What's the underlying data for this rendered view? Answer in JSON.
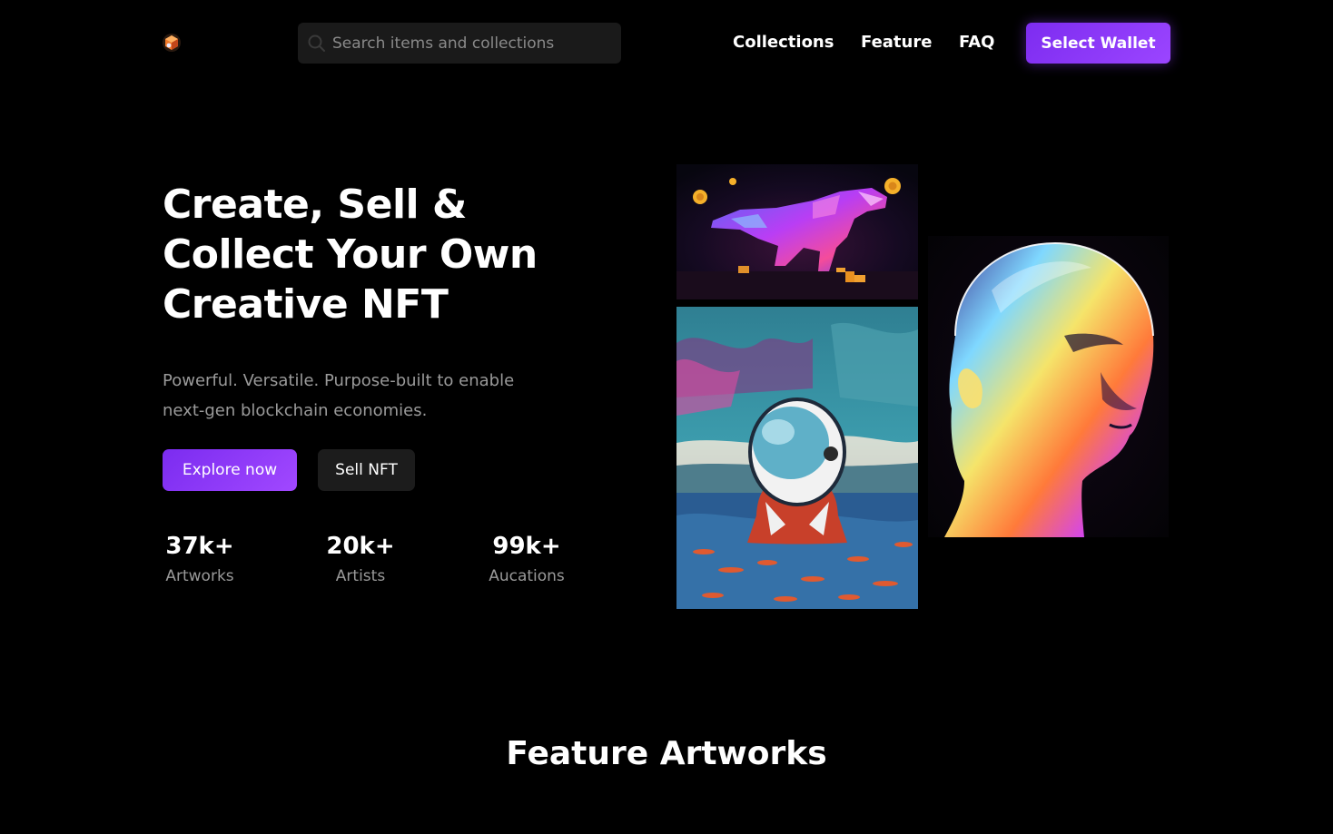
{
  "header": {
    "search": {
      "placeholder": "Search items and collections"
    },
    "nav": [
      "Collections",
      "Feature",
      "FAQ"
    ],
    "wallet_button": "Select Wallet"
  },
  "hero": {
    "title_lines": [
      "Create, Sell &",
      "Collect Your Own",
      "Creative NFT"
    ],
    "subtitle_lines": [
      "Powerful. Versatile. Purpose-built to enable",
      "next-gen blockchain economies."
    ],
    "explore_button": "Explore now",
    "sell_button": "Sell NFT",
    "stats": [
      {
        "value": "37k+",
        "label": "Artworks"
      },
      {
        "value": "20k+",
        "label": "Artists"
      },
      {
        "value": "99k+",
        "label": "Aucations"
      }
    ]
  },
  "artworks": [
    {
      "name": "crystal-dinosaur"
    },
    {
      "name": "astronaut-in-sea"
    },
    {
      "name": "holographic-head"
    }
  ],
  "feature_section": {
    "title": "Feature Artworks"
  },
  "colors": {
    "background": "#000000",
    "accent": "#8a3cff",
    "muted_text": "#9a9a9a",
    "search_bg": "#1a1a1a",
    "secondary_button_bg": "#1c1c1c"
  }
}
